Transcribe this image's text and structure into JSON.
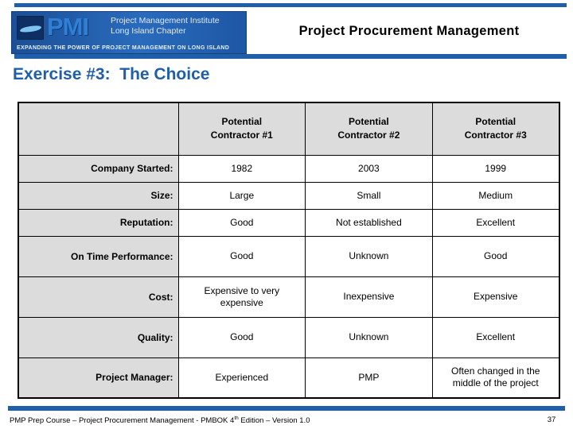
{
  "header": {
    "title": "Project Procurement Management",
    "logo": {
      "mark_text": "PMI",
      "org_line1": "Project Management Institute",
      "org_line2": "Long Island Chapter",
      "tagline": "EXPANDING THE POWER OF PROJECT MANAGEMENT ON LONG ISLAND"
    },
    "accent_color": "#1F5FA9"
  },
  "slide": {
    "heading": "Exercise #3:  The Choice"
  },
  "table": {
    "corner_label": "",
    "columns": [
      "Potential Contractor #1",
      "Potential Contractor #2",
      "Potential Contractor #3"
    ],
    "columns_split": [
      {
        "line1": "Potential",
        "line2": "Contractor #1"
      },
      {
        "line1": "Potential",
        "line2": "Contractor #2"
      },
      {
        "line1": "Potential",
        "line2": "Contractor #3"
      }
    ],
    "rows": [
      {
        "label": "Company Started:",
        "values": [
          "1982",
          "2003",
          "1999"
        ]
      },
      {
        "label": "Size:",
        "values": [
          "Large",
          "Small",
          "Medium"
        ]
      },
      {
        "label": "Reputation:",
        "values": [
          "Good",
          "Not established",
          "Excellent"
        ]
      },
      {
        "label": "On Time Performance:",
        "values": [
          "Good",
          "Unknown",
          "Good"
        ]
      },
      {
        "label": "Cost:",
        "values": [
          "Expensive to very expensive",
          "Inexpensive",
          "Expensive"
        ]
      },
      {
        "label": "Quality:",
        "values": [
          "Good",
          "Unknown",
          "Excellent"
        ]
      },
      {
        "label": "Project Manager:",
        "values": [
          "Experienced",
          "PMP",
          "Often changed in the middle of the project"
        ]
      }
    ],
    "header_bg": "#DCDCDC",
    "label_bg": "#DCDCDC",
    "cell_bg": "#FFFFFF"
  },
  "footer": {
    "text_before_sup": "PMP Prep Course – Project Procurement Management - PMBOK 4",
    "sup": "th",
    "text_after_sup": " Edition – Version 1.0",
    "page_number": "37"
  }
}
